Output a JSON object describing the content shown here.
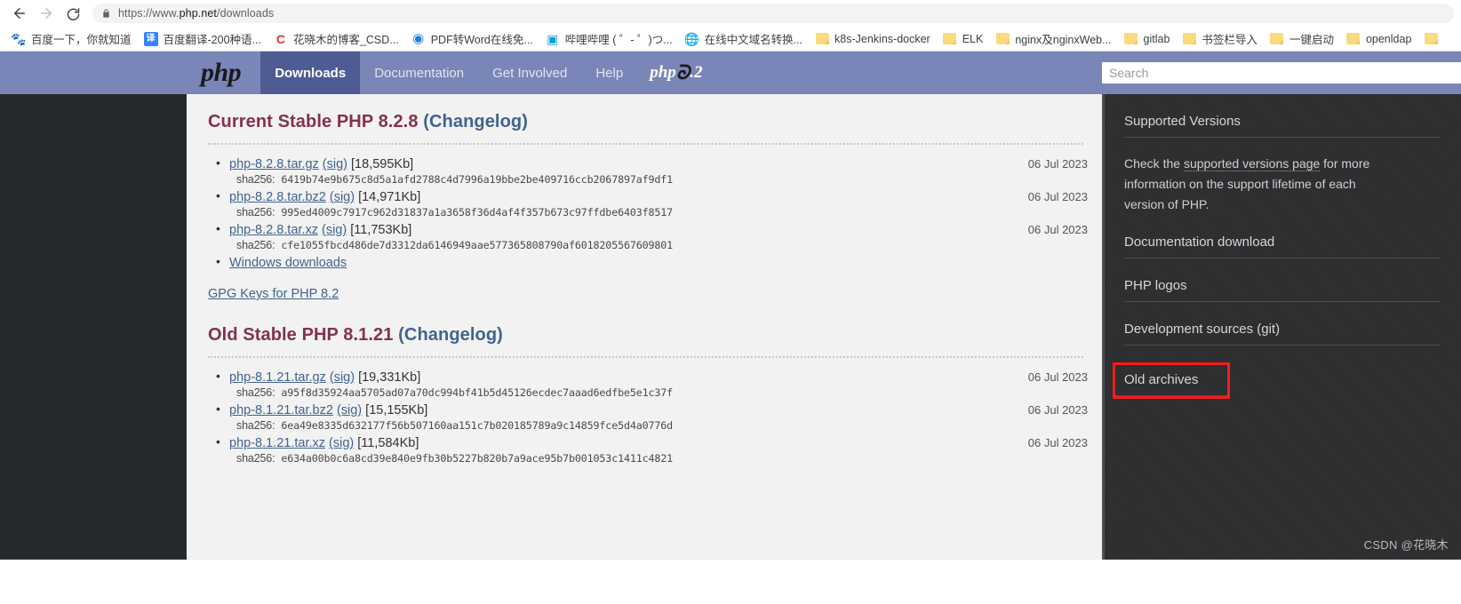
{
  "browser": {
    "back_title": "Back",
    "forward_title": "Forward",
    "reload_title": "Reload",
    "url_scheme": "https://www.",
    "url_host": "php.net",
    "url_path": "/downloads",
    "url_full": "https://www.php.net/downloads"
  },
  "bookmarks": [
    {
      "label": "百度一下，你就知道",
      "icon": "baidu-paw-icon",
      "icon_class": "fav-baidu",
      "glyph": "🐾"
    },
    {
      "label": "百度翻译-200种语...",
      "icon": "baidu-translate-icon",
      "icon_class": "fav-fanyi",
      "glyph": "译"
    },
    {
      "label": "花晓木的博客_CSD...",
      "icon": "csdn-icon",
      "icon_class": "fav-csdn",
      "glyph": "C"
    },
    {
      "label": "PDF转Word在线免...",
      "icon": "pdf-convert-icon",
      "icon_class": "fav-pdf",
      "glyph": "◉"
    },
    {
      "label": "哔哩哔哩 ( ゜- ゜)つ...",
      "icon": "bilibili-icon",
      "icon_class": "fav-bili",
      "glyph": "▣"
    },
    {
      "label": "在线中文域名转换...",
      "icon": "globe-icon",
      "icon_class": "fav-globe",
      "glyph": "🌐"
    },
    {
      "label": "k8s-Jenkins-docker",
      "icon": "folder-icon",
      "icon_class": "folder",
      "glyph": ""
    },
    {
      "label": "ELK",
      "icon": "folder-icon",
      "icon_class": "folder",
      "glyph": ""
    },
    {
      "label": "nginx及nginxWeb...",
      "icon": "folder-icon",
      "icon_class": "folder",
      "glyph": ""
    },
    {
      "label": "gitlab",
      "icon": "folder-icon",
      "icon_class": "folder",
      "glyph": ""
    },
    {
      "label": "书签栏导入",
      "icon": "folder-icon",
      "icon_class": "folder",
      "glyph": ""
    },
    {
      "label": "一键启动",
      "icon": "folder-icon",
      "icon_class": "folder",
      "glyph": ""
    },
    {
      "label": "openldap",
      "icon": "folder-icon",
      "icon_class": "folder",
      "glyph": ""
    },
    {
      "label": "",
      "icon": "folder-icon",
      "icon_class": "folder",
      "glyph": ""
    }
  ],
  "navbar": {
    "logo": "php",
    "items": [
      {
        "label": "Downloads",
        "active": true
      },
      {
        "label": "Documentation",
        "active": false
      },
      {
        "label": "Get Involved",
        "active": false
      },
      {
        "label": "Help",
        "active": false
      }
    ],
    "version_badge": "php 8.2",
    "version_badge_prefix": "php",
    "version_badge_suffix": ".2",
    "search_placeholder": "Search",
    "search_value": ""
  },
  "sections": [
    {
      "heading": "Current Stable PHP 8.2.8",
      "changelog_label": "(Changelog)",
      "downloads": [
        {
          "name": "php-8.2.8.tar.gz",
          "sig": "(sig)",
          "size": "[18,595Kb]",
          "date": "06 Jul 2023",
          "sha_label": "sha256:",
          "sha": "6419b74e9b675c8d5a1afd2788c4d7996a19bbe2be409716ccb2067897af9df1"
        },
        {
          "name": "php-8.2.8.tar.bz2",
          "sig": "(sig)",
          "size": "[14,971Kb]",
          "date": "06 Jul 2023",
          "sha_label": "sha256:",
          "sha": "995ed4009c7917c962d31837a1a3658f36d4af4f357b673c97ffdbe6403f8517"
        },
        {
          "name": "php-8.2.8.tar.xz",
          "sig": "(sig)",
          "size": "[11,753Kb]",
          "date": "06 Jul 2023",
          "sha_label": "sha256:",
          "sha": "cfe1055fbcd486de7d3312da6146949aae577365808790af6018205567609801"
        },
        {
          "name": "Windows downloads",
          "sig": "",
          "size": "",
          "date": "",
          "sha_label": "",
          "sha": ""
        }
      ],
      "gpg_link": "GPG Keys for PHP 8.2"
    },
    {
      "heading": "Old Stable PHP 8.1.21",
      "changelog_label": "(Changelog)",
      "downloads": [
        {
          "name": "php-8.1.21.tar.gz",
          "sig": "(sig)",
          "size": "[19,331Kb]",
          "date": "06 Jul 2023",
          "sha_label": "sha256:",
          "sha": "a95f8d35924aa5705ad07a70dc994bf41b5d45126ecdec7aaad6edfbe5e1c37f"
        },
        {
          "name": "php-8.1.21.tar.bz2",
          "sig": "(sig)",
          "size": "[15,155Kb]",
          "date": "06 Jul 2023",
          "sha_label": "sha256:",
          "sha": "6ea49e8335d632177f56b507160aa151c7b020185789a9c14859fce5d4a0776d"
        },
        {
          "name": "php-8.1.21.tar.xz",
          "sig": "(sig)",
          "size": "[11,584Kb]",
          "date": "06 Jul 2023",
          "sha_label": "sha256:",
          "sha": "e634a00b0c6a8cd39e840e9fb30b5227b820b7a9ace95b7b001053c1411c4821"
        }
      ],
      "gpg_link": ""
    }
  ],
  "sidebar": {
    "heading": "Supported Versions",
    "paragraph_before": "Check the ",
    "paragraph_link": "supported versions page",
    "paragraph_after": " for more information on the support lifetime of each version of PHP.",
    "links": [
      {
        "label": "Documentation download",
        "highlighted": false
      },
      {
        "label": "PHP logos",
        "highlighted": false
      },
      {
        "label": "Development sources (git)",
        "highlighted": false
      },
      {
        "label": "Old archives",
        "highlighted": true
      }
    ],
    "highlight_color": "#fc1b1b"
  },
  "watermark": "CSDN @花晓木"
}
